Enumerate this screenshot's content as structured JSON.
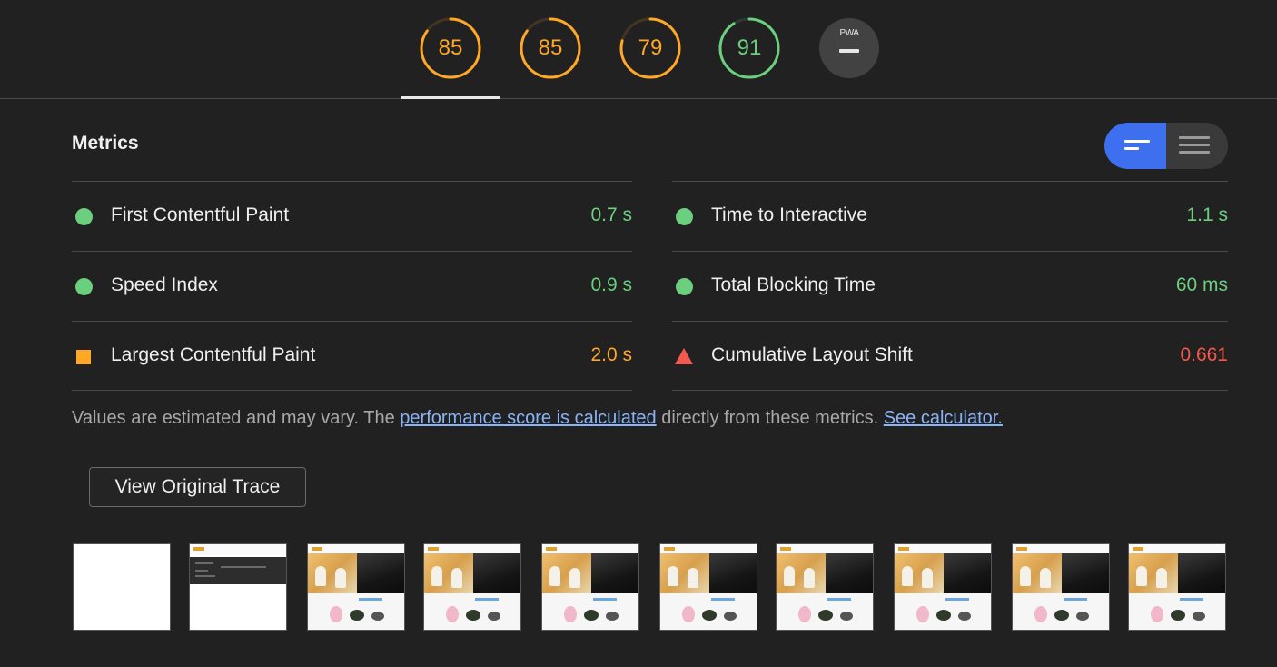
{
  "gauges": [
    {
      "score": "85",
      "rating": "average",
      "ratio": 0.85
    },
    {
      "score": "85",
      "rating": "average",
      "ratio": 0.85
    },
    {
      "score": "79",
      "rating": "average",
      "ratio": 0.79
    },
    {
      "score": "91",
      "rating": "pass",
      "ratio": 0.91
    }
  ],
  "pwa": {
    "label": "PWA"
  },
  "colors": {
    "pass": "#6ccf7f",
    "average": "#ffa726",
    "fail": "#f25a4f",
    "accent": "#3d6fee",
    "link": "#8ab4f8"
  },
  "metrics": {
    "title": "Metrics",
    "left": [
      {
        "label": "First Contentful Paint",
        "value": "0.7 s",
        "rating": "pass",
        "icon": "circle-icon"
      },
      {
        "label": "Speed Index",
        "value": "0.9 s",
        "rating": "pass",
        "icon": "circle-icon"
      },
      {
        "label": "Largest Contentful Paint",
        "value": "2.0 s",
        "rating": "average",
        "icon": "square-icon"
      }
    ],
    "right": [
      {
        "label": "Time to Interactive",
        "value": "1.1 s",
        "rating": "pass",
        "icon": "circle-icon"
      },
      {
        "label": "Total Blocking Time",
        "value": "60 ms",
        "rating": "pass",
        "icon": "circle-icon"
      },
      {
        "label": "Cumulative Layout Shift",
        "value": "0.661",
        "rating": "fail",
        "icon": "triangle-icon"
      }
    ]
  },
  "note": {
    "prefix": "Values are estimated and may vary. The ",
    "link1": "performance score is calculated",
    "middle": " directly from these metrics. ",
    "link2": "See calculator."
  },
  "trace_button": {
    "label": "View Original Trace"
  },
  "filmstrip": {
    "frames": [
      "blank",
      "loading",
      "loaded",
      "loaded",
      "loaded",
      "loaded",
      "loaded",
      "loaded",
      "loaded",
      "loaded"
    ]
  }
}
